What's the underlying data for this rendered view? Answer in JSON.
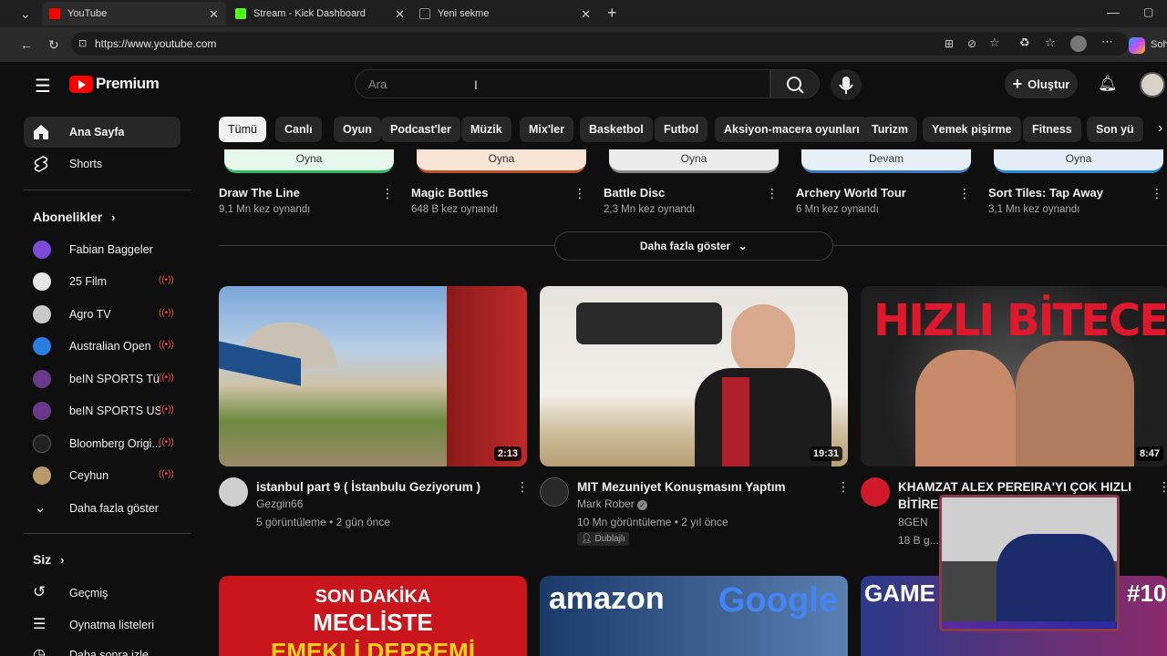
{
  "browser": {
    "tabs": [
      {
        "title": "YouTube",
        "icon": "youtube-icon",
        "color": "#ff0000"
      },
      {
        "title": "Stream - Kick Dashboard",
        "icon": "kick-icon",
        "color": "#53fc18"
      },
      {
        "title": "Yeni sekme",
        "icon": "newtab-icon",
        "color": "#888888"
      }
    ],
    "url": "https://www.youtube.com",
    "profile_label": "Soh"
  },
  "yt": {
    "logo_text": "Premium",
    "search_placeholder": "Ara",
    "create_label": "Oluştur"
  },
  "sidebar": {
    "items": [
      {
        "label": "Ana Sayfa",
        "icon": "home-icon"
      },
      {
        "label": "Shorts",
        "icon": "shorts-icon"
      }
    ],
    "subs_heading": "Abonelikler",
    "subs": [
      {
        "label": "Fabian Baggeler",
        "live": false,
        "color": "#7a4bd6"
      },
      {
        "label": "25 Film",
        "live": true,
        "color": "#e6e6e6"
      },
      {
        "label": "Agro TV",
        "live": true,
        "color": "#c9c9c9"
      },
      {
        "label": "Australian Open",
        "live": true,
        "color": "#2a7de1"
      },
      {
        "label": "beIN SPORTS Tü...",
        "live": true,
        "color": "#6a3a8a"
      },
      {
        "label": "beIN SPORTS USA",
        "live": true,
        "color": "#6a3a8a"
      },
      {
        "label": "Bloomberg Origi...",
        "live": true,
        "color": "#222222"
      },
      {
        "label": "Ceyhun",
        "live": true,
        "color": "#b89a6a"
      }
    ],
    "show_more": "Daha fazla göster",
    "you_heading": "Siz",
    "you_items": [
      {
        "label": "Geçmiş",
        "icon": "history-icon"
      },
      {
        "label": "Oynatma listeleri",
        "icon": "playlist-icon"
      },
      {
        "label": "Daha sonra izle",
        "icon": "watch-later-icon"
      }
    ]
  },
  "chips": [
    "Tümü",
    "Canlı",
    "Oyun",
    "Podcast'ler",
    "Müzik",
    "Mix'ler",
    "Basketbol",
    "Futbol",
    "Aksiyon-macera oyunları",
    "Turizm",
    "Yemek pişirme",
    "Fitness",
    "Son yü"
  ],
  "games": [
    {
      "button": "Oyna",
      "title": "Draw The Line",
      "plays": "9,1 Mn kez oynandı",
      "btn_color": "#e6f6ec"
    },
    {
      "button": "Oyna",
      "title": "Magic Bottles",
      "plays": "648 B kez oynandı",
      "btn_color": "#f6e4d6"
    },
    {
      "button": "Oyna",
      "title": "Battle Disc",
      "plays": "2,3 Mn kez oynandı",
      "btn_color": "#ececec"
    },
    {
      "button": "Devam",
      "title": "Archery World Tour",
      "plays": "6 Mn kez oynandı",
      "btn_color": "#e6eef8"
    },
    {
      "button": "Oyna",
      "title": "Sort Tiles: Tap Away",
      "plays": "3,1 Mn kez oynandı",
      "btn_color": "#e4eef8"
    }
  ],
  "more_button": "Daha fazla göster",
  "videos": [
    {
      "title": "istanbul part 9 ( İstanbulu Geziyorum )",
      "channel": "Gezgin66",
      "meta": "5 görüntüleme • 2 gün önce",
      "duration": "2:13",
      "extra": ""
    },
    {
      "title": "MIT Mezuniyet Konuşmasını Yaptım",
      "channel": "Mark Rober",
      "meta": "10 Mn görüntüleme • 2 yıl önce",
      "duration": "19:31",
      "extra": "Dublajlı"
    },
    {
      "title": "KHAMZAT ALEX PEREIRA'YI ÇOK HIZLI BİTİREC... YOR",
      "channel": "8GEN",
      "meta": "18 B g...",
      "duration": "8:47",
      "extra": ""
    }
  ],
  "thumb_texts": {
    "hizli": "HIZLI BİTECEK",
    "son_dakika": "SON DAKİKA",
    "mecliste": "MECLİSTE",
    "emekli": "EMEKLİ DEPREMİ",
    "amazon": "amazon",
    "google": "Google",
    "game": "GAME",
    "ten": "#10"
  }
}
